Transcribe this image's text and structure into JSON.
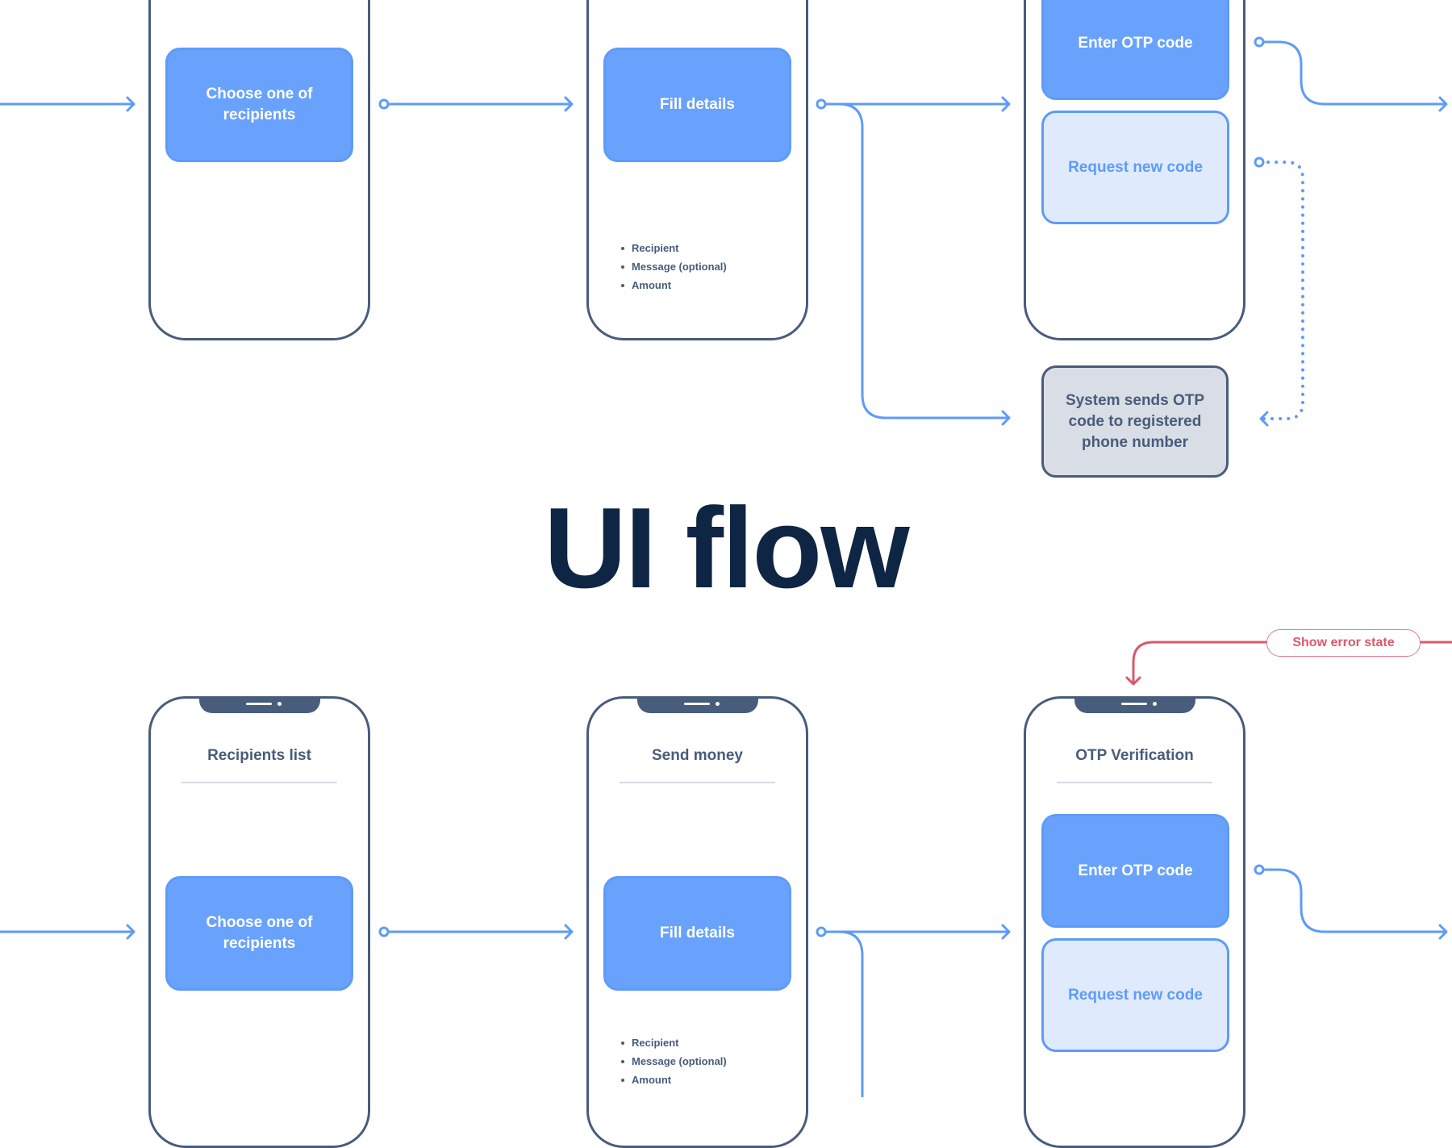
{
  "title": "UI flow",
  "colors": {
    "flow_line": "#5e9bf8",
    "phone_outline": "#485c7b",
    "primary_button": "#68a2fc",
    "secondary_button": "#dfeafd",
    "system_box": "#d9dde5",
    "error": "#d9596b",
    "title": "#0f2544"
  },
  "top_flow": {
    "screen1": {
      "action": "Choose one of recipients"
    },
    "screen2": {
      "action": "Fill details",
      "fields": [
        "Recipient",
        "Message (optional)",
        "Amount"
      ]
    },
    "screen3": {
      "primary_action": "Enter OTP code",
      "secondary_action": "Request new code"
    },
    "system_step": "System sends OTP code to registered phone number"
  },
  "bottom_flow": {
    "error_label": "Show error state",
    "screen1": {
      "title": "Recipients list",
      "action": "Choose one of recipients"
    },
    "screen2": {
      "title": "Send money",
      "action": "Fill details",
      "fields": [
        "Recipient",
        "Message (optional)",
        "Amount"
      ]
    },
    "screen3": {
      "title": "OTP Verification",
      "primary_action": "Enter OTP code",
      "secondary_action": "Request new code"
    }
  }
}
